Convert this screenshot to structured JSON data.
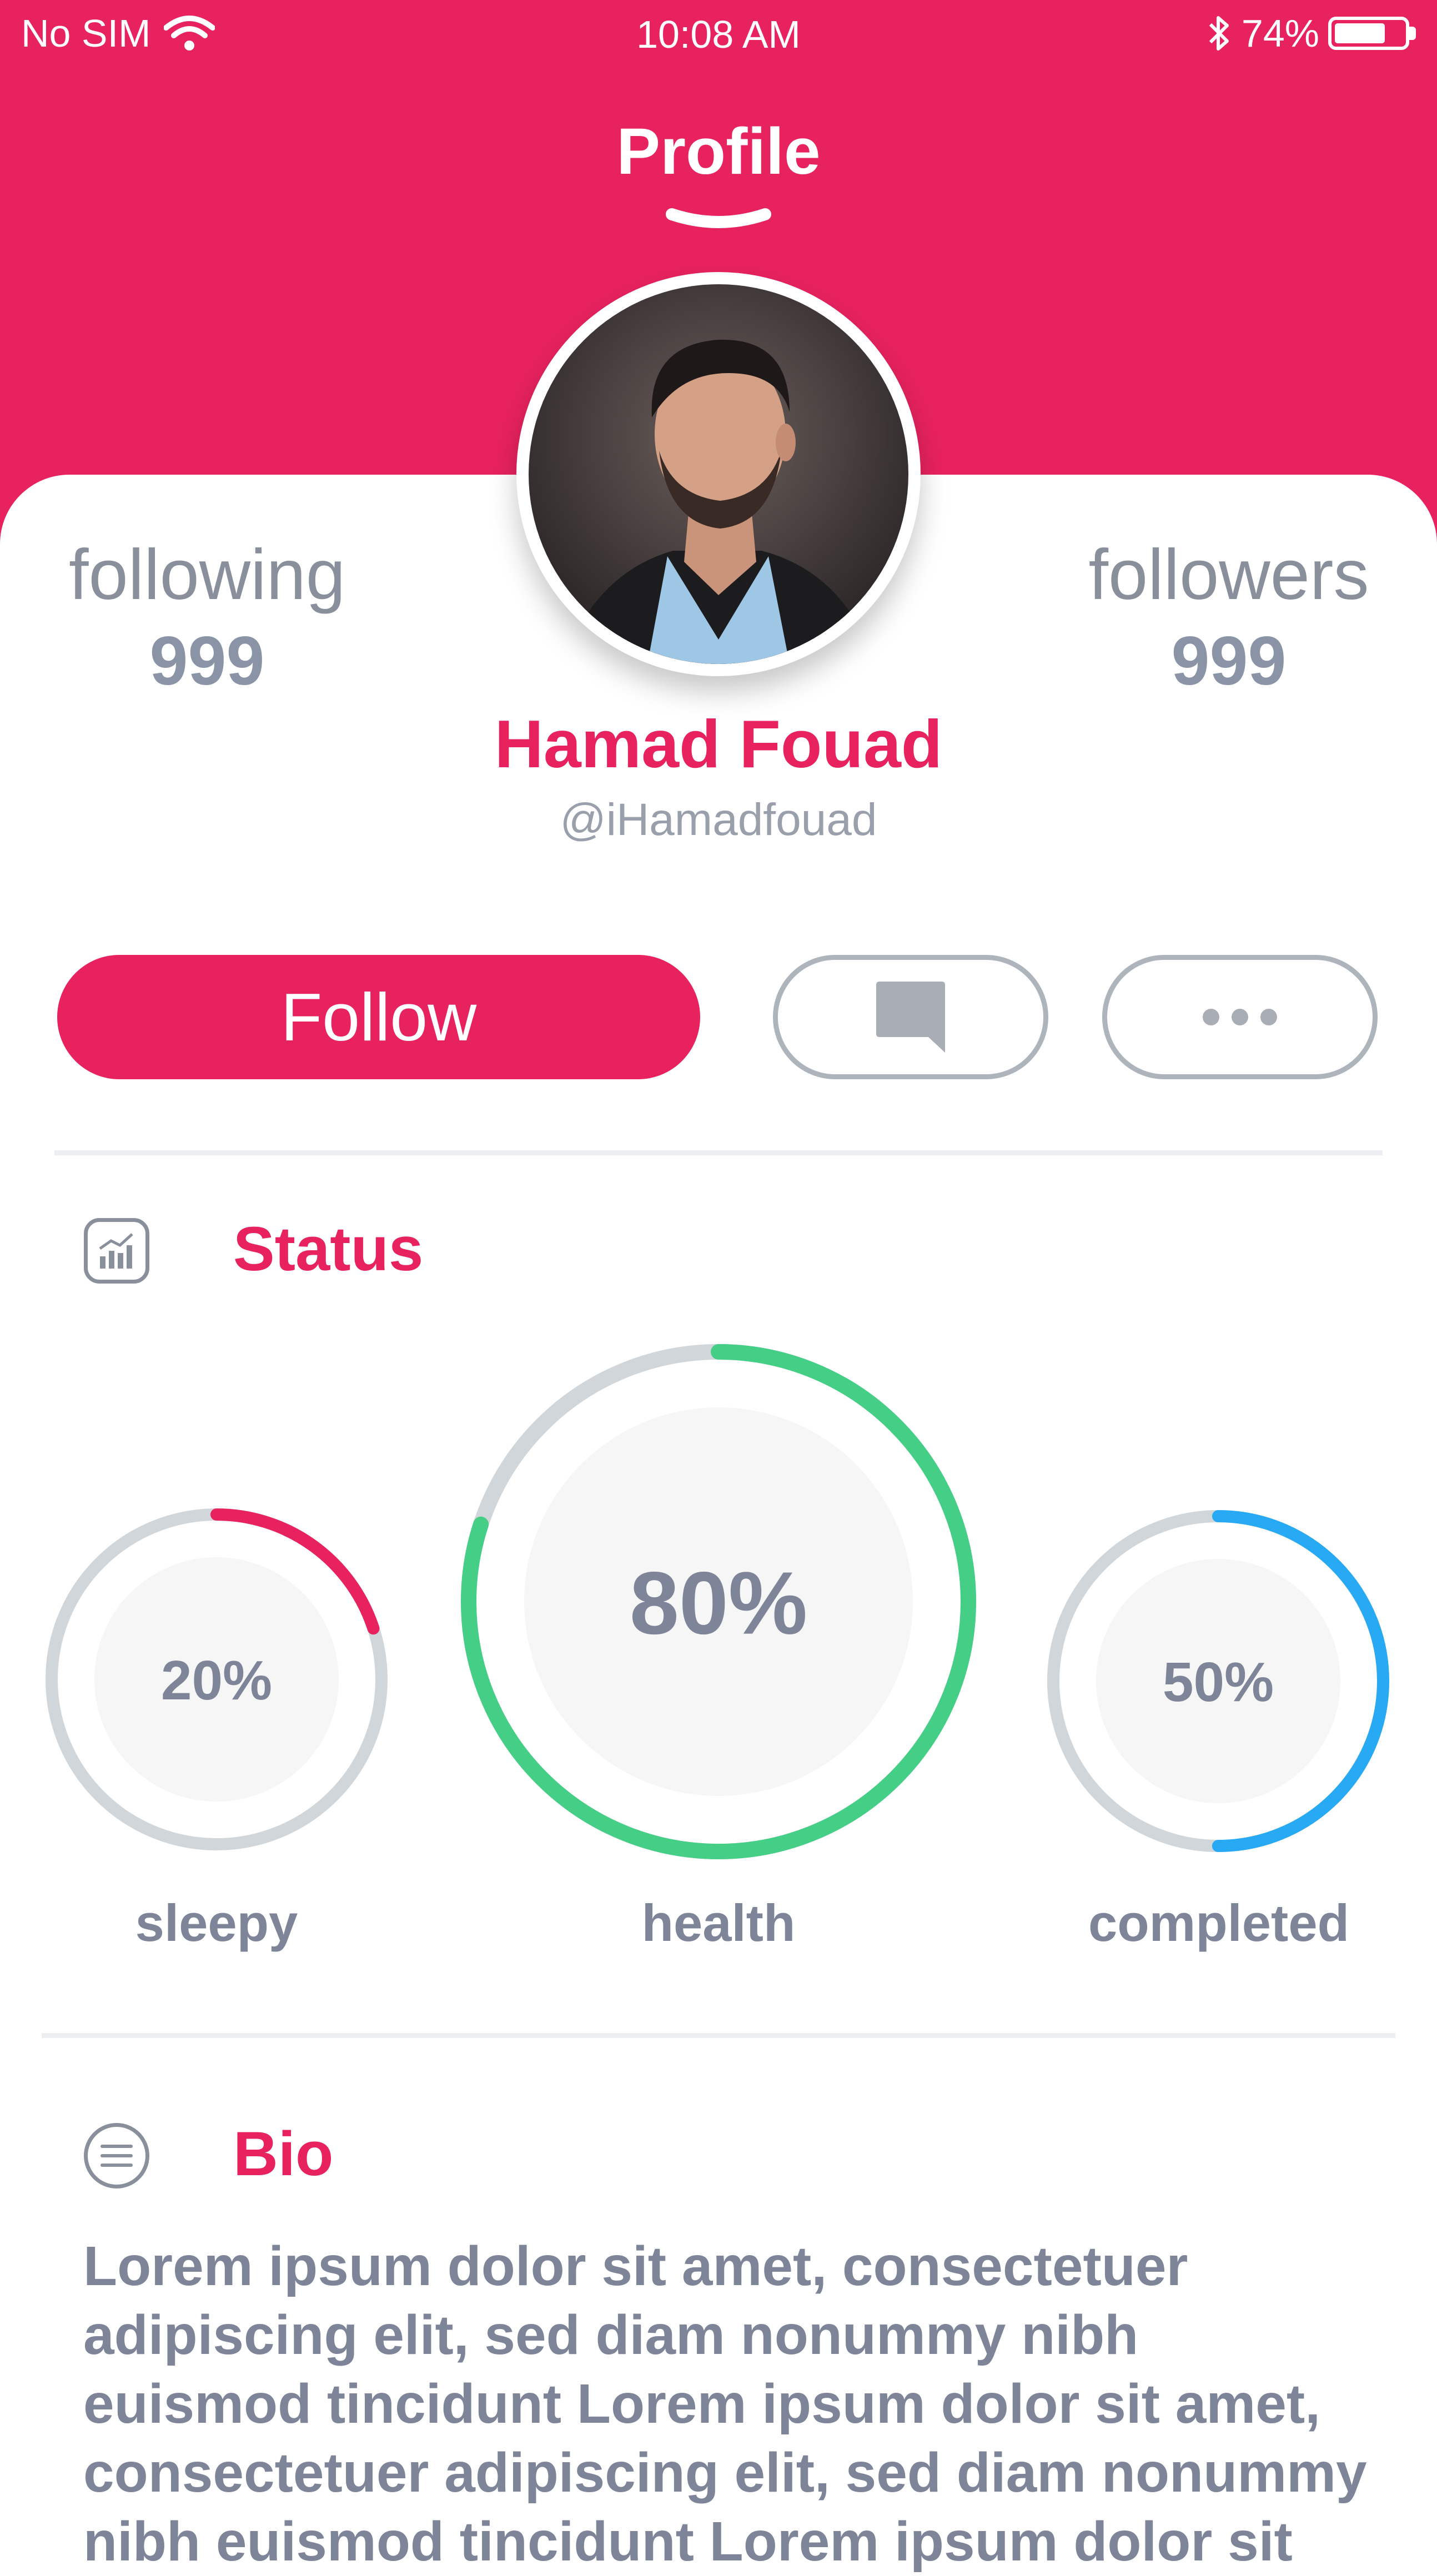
{
  "status_bar": {
    "carrier": "No SIM",
    "time": "10:08 AM",
    "battery_text": "74%",
    "battery_level": 0.74,
    "icons": [
      "wifi-icon",
      "bluetooth-icon",
      "battery-icon"
    ]
  },
  "nav": {
    "title": "Profile",
    "icon": "chevron-down-icon"
  },
  "profile": {
    "name": "Hamad Fouad",
    "handle": "@iHamadfouad",
    "following_label": "following",
    "following_count": "999",
    "followers_label": "followers",
    "followers_count": "999"
  },
  "actions": {
    "follow_label": "Follow",
    "message_icon": "message-icon",
    "more_icon": "more-icon"
  },
  "status_section": {
    "title": "Status",
    "icon": "chart-icon",
    "rings": [
      {
        "label": "sleepy",
        "percent_text": "20%",
        "value": 0.2,
        "color": "#E8225F"
      },
      {
        "label": "health",
        "percent_text": "80%",
        "value": 0.8,
        "color": "#45CE86"
      },
      {
        "label": "completed",
        "percent_text": "50%",
        "value": 0.5,
        "color": "#27A9F3"
      }
    ],
    "track_color": "#D0D6DA",
    "inner_color": "#F6F6F6"
  },
  "bio_section": {
    "title": "Bio",
    "icon": "list-icon",
    "lines": [
      "Lorem ipsum dolor sit amet, consectetuer",
      "adipiscing elit, sed diam nonummy nibh",
      "euismod tincidunt  Lorem ipsum dolor sit amet,",
      "consectetuer adipiscing elit, sed diam nonummy",
      "nibh euismod tincidunt Lorem ipsum dolor sit"
    ]
  },
  "colors": {
    "accent": "#E8225F",
    "muted": "#8A8F9C"
  }
}
